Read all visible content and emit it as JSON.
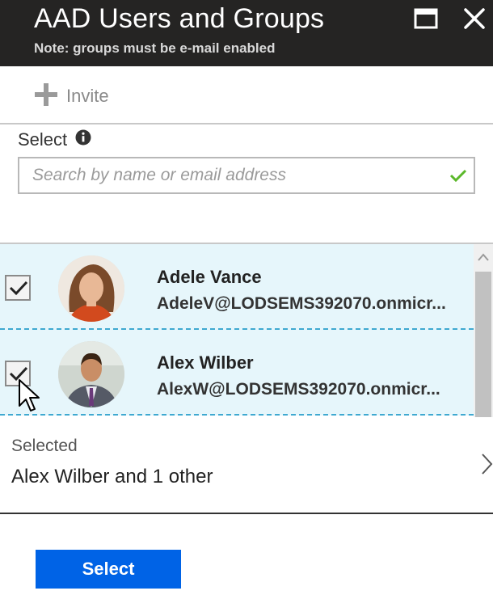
{
  "header": {
    "title": "AAD Users and Groups",
    "subtitle": "Note: groups must be e-mail enabled",
    "maximize_icon": "maximize-icon",
    "close_icon": "close-icon"
  },
  "toolbar": {
    "invite_label": "Invite",
    "invite_icon": "plus-icon"
  },
  "select": {
    "label": "Select",
    "info_icon": "info-icon",
    "search_placeholder": "Search by name or email address",
    "search_value": "",
    "valid_icon": "checkmark-icon"
  },
  "users": [
    {
      "name": "Adele Vance",
      "email": "AdeleV@LODSEMS392070.onmicr...",
      "checked": true
    },
    {
      "name": "Alex Wilber",
      "email": "AlexW@LODSEMS392070.onmicr...",
      "checked": true
    }
  ],
  "selected": {
    "label": "Selected",
    "value": "Alex Wilber and 1 other"
  },
  "select_button": "Select",
  "colors": {
    "header_bg": "#252423",
    "row_bg": "#e6f6fb",
    "row_divider": "#3fa9d1",
    "accent_button": "#0063e6",
    "valid_check": "#5bb82a"
  }
}
